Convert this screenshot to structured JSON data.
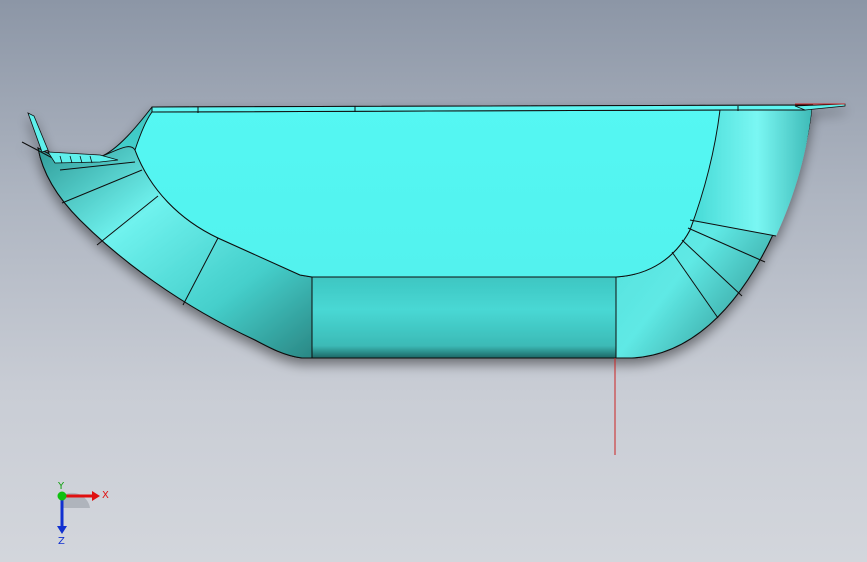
{
  "viewport": {
    "background_top": "#8c96a6",
    "background_bottom": "#d3d6dc"
  },
  "model": {
    "face_color": "#55fbf6",
    "edge_color": "#1a1a1a",
    "sketch_line_color": "#cc2222"
  },
  "triad": {
    "x_label": "X",
    "y_label": "Y",
    "z_label": "Z",
    "x_color": "#e01010",
    "y_color": "#10c010",
    "z_color": "#1030d0"
  }
}
